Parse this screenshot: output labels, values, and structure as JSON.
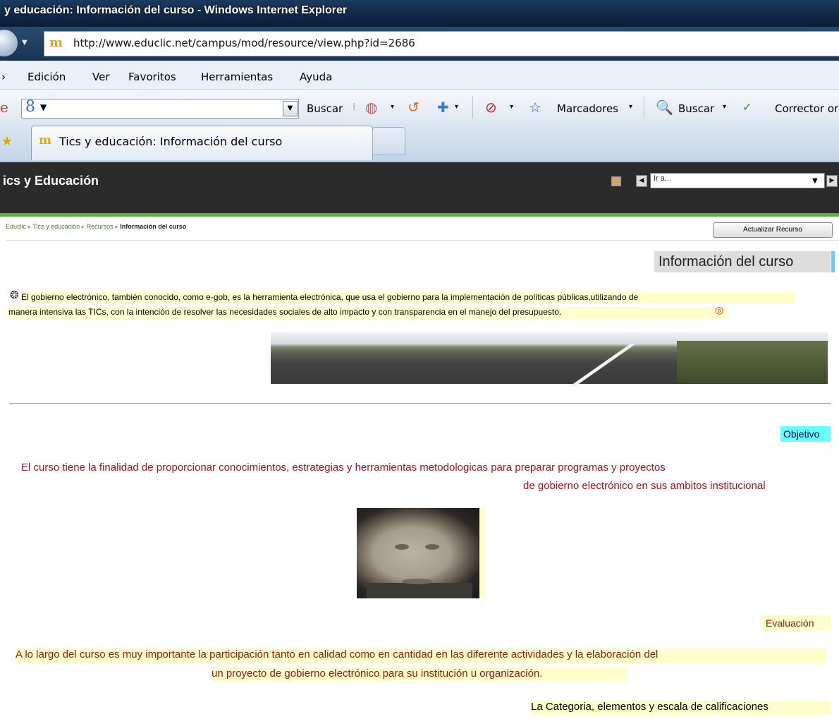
{
  "window": {
    "title": "y educación: Información del curso - Windows Internet Explorer",
    "address": "http://www.educlic.net/campus/mod/resource/view.php?id=2686"
  },
  "menu": [
    "Edición",
    "Ver",
    "Favoritos",
    "Herramientas",
    "Ayuda"
  ],
  "menu_partial_first": "›",
  "google_toolbar": {
    "logo_partial": "e",
    "buscar_label": "Buscar",
    "marcadores_label": "Marcadores",
    "buscar2_label": "Buscar",
    "corrector_label": "Corrector or"
  },
  "tab": {
    "label": "Tics y educación: Información del curso"
  },
  "site": {
    "title": "ics y Educación",
    "jump_placeholder": "Ir a..."
  },
  "breadcrumb": [
    "Educlic",
    "Tics y educación",
    "Recursos",
    "Información del curso"
  ],
  "update_button": "Actualizar Recurso",
  "content": {
    "heading": "Información del curso",
    "intro_line1": "El gobierno electrónico, también conocido, como e-gob, es la herramienta electrónica, que usa el gobierno para la implementación de  políticas públicas,utilizando de",
    "intro_line2": "manera intensiva las TICs, con la intención de resolver las necesidades sociales de alto impacto y con transparencia en el manejo del presupuesto.",
    "objetivo_label": "Objetivo",
    "objetivo_line1": "El curso tiene la finalidad de proporcionar conocimientos, estrategias y  herramientas metodologicas para preparar programas y proyectos",
    "objetivo_line2": "de gobierno electrónico en sus ambitos institucional",
    "evaluacion_label": "Evaluación",
    "evaluacion_line1": "A lo largo del curso es muy importante la participación tanto en calidad como en cantidad en las diferente actividades y la elaboración del",
    "evaluacion_line2": "un proyecto de gobierno electrónico para su institución u organización.",
    "categoria_line": "La Categoria, elementos y escala de calificaciones"
  },
  "colors": {
    "header_bg": "#2b2b2b",
    "accent_green": "#6aa84f",
    "objetivo_bg": "#66ffff",
    "highlight": "#ffffcc",
    "red_text": "#a31414"
  }
}
